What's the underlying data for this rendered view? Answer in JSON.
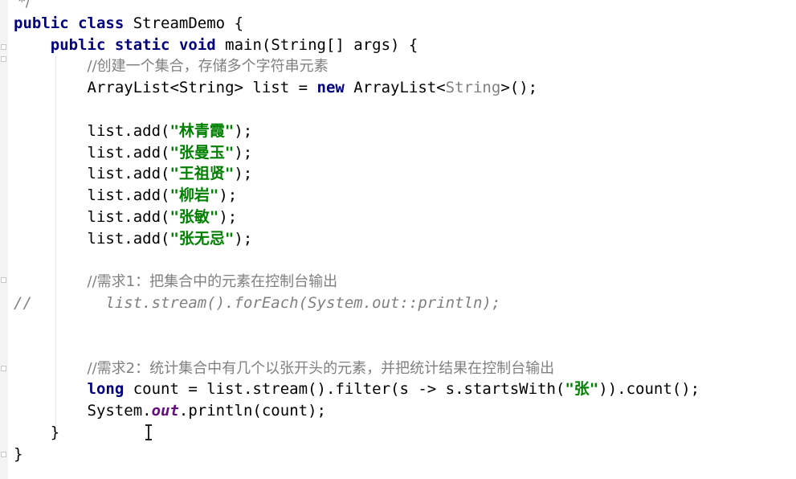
{
  "editor": {
    "lines": [
      {
        "id": "l0",
        "parts": [
          {
            "t": " */",
            "c": "cm"
          }
        ]
      },
      {
        "id": "l1",
        "parts": [
          {
            "t": "public",
            "c": "kw"
          },
          {
            "t": " "
          },
          {
            "t": "class",
            "c": "kw"
          },
          {
            "t": " StreamDemo {"
          }
        ]
      },
      {
        "id": "l2",
        "parts": [
          {
            "t": "    "
          },
          {
            "t": "public",
            "c": "kw"
          },
          {
            "t": " "
          },
          {
            "t": "static",
            "c": "kw"
          },
          {
            "t": " "
          },
          {
            "t": "void",
            "c": "kw"
          },
          {
            "t": " main(String[] args) {"
          }
        ]
      },
      {
        "id": "l3",
        "parts": [
          {
            "t": "        "
          },
          {
            "t": "//创建一个集合，存储多个字符串元素",
            "c": "cm"
          }
        ]
      },
      {
        "id": "l4",
        "parts": [
          {
            "t": "        ArrayList<String> list = "
          },
          {
            "t": "new",
            "c": "kw"
          },
          {
            "t": " ArrayList<"
          },
          {
            "t": "String",
            "c": "gen"
          },
          {
            "t": ">();"
          }
        ]
      },
      {
        "id": "l5",
        "parts": []
      },
      {
        "id": "l6",
        "parts": [
          {
            "t": "        list.add("
          },
          {
            "t": "\"林青霞\"",
            "c": "str"
          },
          {
            "t": ");"
          }
        ]
      },
      {
        "id": "l7",
        "parts": [
          {
            "t": "        list.add("
          },
          {
            "t": "\"张曼玉\"",
            "c": "str"
          },
          {
            "t": ");"
          }
        ]
      },
      {
        "id": "l8",
        "parts": [
          {
            "t": "        list.add("
          },
          {
            "t": "\"王祖贤\"",
            "c": "str"
          },
          {
            "t": ");"
          }
        ]
      },
      {
        "id": "l9",
        "parts": [
          {
            "t": "        list.add("
          },
          {
            "t": "\"柳岩\"",
            "c": "str"
          },
          {
            "t": ");"
          }
        ]
      },
      {
        "id": "l10",
        "parts": [
          {
            "t": "        list.add("
          },
          {
            "t": "\"张敏\"",
            "c": "str"
          },
          {
            "t": ");"
          }
        ]
      },
      {
        "id": "l11",
        "parts": [
          {
            "t": "        list.add("
          },
          {
            "t": "\"张无忌\"",
            "c": "str"
          },
          {
            "t": ");"
          }
        ]
      },
      {
        "id": "l12",
        "parts": []
      },
      {
        "id": "l13",
        "parts": [
          {
            "t": "        "
          },
          {
            "t": "//需求1：把集合中的元素在控制台输出",
            "c": "cm"
          }
        ]
      },
      {
        "id": "l14",
        "parts": [
          {
            "t": "//",
            "c": "cmi"
          },
          {
            "t": "        "
          },
          {
            "t": "list.stream().forEach(System.out::println);",
            "c": "cmi"
          }
        ]
      },
      {
        "id": "l15",
        "parts": []
      },
      {
        "id": "l16",
        "parts": []
      },
      {
        "id": "l17",
        "parts": [
          {
            "t": "        "
          },
          {
            "t": "//需求2：统计集合中有几个以张开头的元素，并把统计结果在控制台输出",
            "c": "cm"
          }
        ]
      },
      {
        "id": "l18",
        "parts": [
          {
            "t": "        "
          },
          {
            "t": "long",
            "c": "kw"
          },
          {
            "t": " count = list.stream().filter(s -> s.startsWith("
          },
          {
            "t": "\"张\"",
            "c": "str"
          },
          {
            "t": ")).count();"
          }
        ]
      },
      {
        "id": "l19",
        "parts": [
          {
            "t": "        System."
          },
          {
            "t": "out",
            "c": "fld"
          },
          {
            "t": ".println(count);"
          }
        ]
      },
      {
        "id": "l20",
        "parts": [
          {
            "t": "    }"
          }
        ]
      },
      {
        "id": "l21",
        "parts": [
          {
            "t": "}"
          }
        ]
      }
    ]
  },
  "colors": {
    "keyword": "#000080",
    "string": "#008000",
    "comment": "#808080",
    "static_field": "#660e7a",
    "background": "#ffffff"
  },
  "icons": {
    "fold_marker": "fold-marker-icon",
    "text_cursor": "text-cursor-icon"
  }
}
